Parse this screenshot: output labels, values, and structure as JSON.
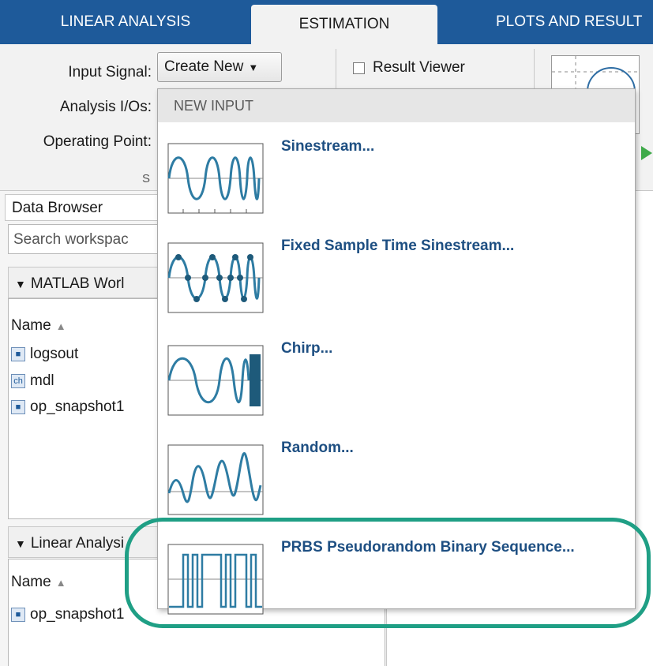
{
  "tabs": [
    "LINEAR ANALYSIS",
    "ESTIMATION",
    "PLOTS AND RESULT"
  ],
  "toolstrip": {
    "input_signal_label": "Input Signal:",
    "create_new_label": "Create New",
    "analysis_ios_label": "Analysis I/Os:",
    "operating_point_label": "Operating Point:",
    "result_viewer_label": "Result Viewer",
    "section_label_fragment": "S"
  },
  "browser": {
    "title": "Data Browser",
    "search_placeholder": "Search workspac",
    "workspace_header": "MATLAB Worl",
    "linear_header": "Linear Analysi",
    "name_column": "Name",
    "workspace_vars": [
      {
        "name": "logsout",
        "icon": "struct-icon"
      },
      {
        "name": "mdl",
        "icon": "char-icon"
      },
      {
        "name": "op_snapshot1",
        "icon": "struct-icon"
      }
    ],
    "linear_vars": [
      {
        "name": "op_snapshot1",
        "icon": "struct-icon"
      }
    ]
  },
  "menu": {
    "header": "NEW INPUT",
    "items": [
      {
        "label": "Sinestream...",
        "icon": "sinestream-icon"
      },
      {
        "label": "Fixed Sample Time Sinestream...",
        "icon": "fixed-sample-sinestream-icon"
      },
      {
        "label": "Chirp...",
        "icon": "chirp-icon"
      },
      {
        "label": "Random...",
        "icon": "random-signal-icon"
      },
      {
        "label": "PRBS Pseudorandom Binary Sequence...",
        "icon": "prbs-icon"
      }
    ]
  },
  "colors": {
    "tab_bar": "#1e5a9a",
    "menu_label": "#1e4f82",
    "signal_line": "#2e7ca3",
    "highlight": "#1f9f85"
  }
}
